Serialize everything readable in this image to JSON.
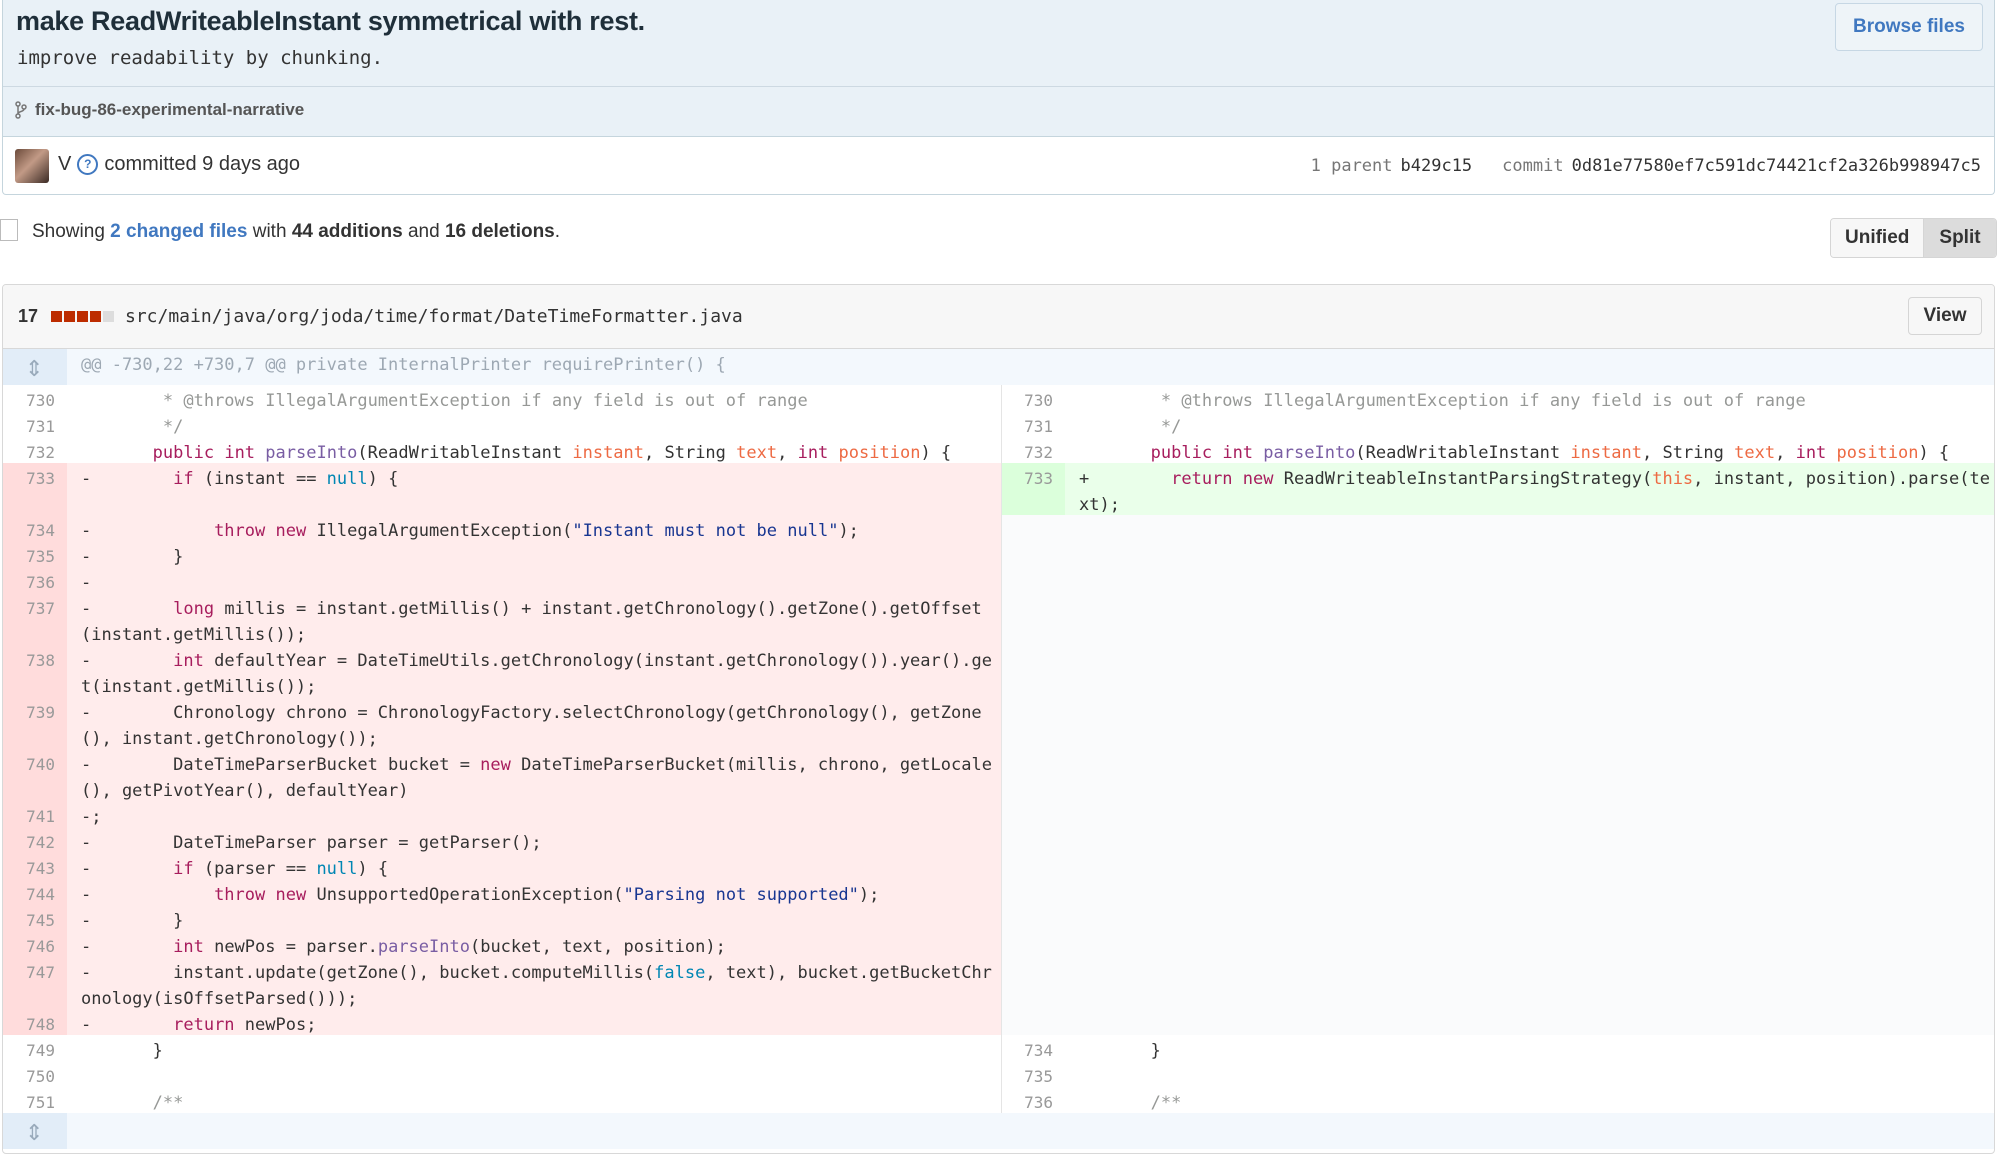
{
  "commit": {
    "title": "make ReadWriteableInstant symmetrical with rest.",
    "description": "improve readability by chunking.",
    "branch": "fix-bug-86-experimental-narrative",
    "browse_files_label": "Browse files",
    "author": "V",
    "committed_text": "committed 9 days ago",
    "parent_label": "1 parent",
    "parent_sha": "b429c15",
    "commit_label": "commit",
    "commit_sha": "0d81e77580ef7c591dc74421cf2a326b998947c5"
  },
  "toc": {
    "showing": "Showing",
    "changed_files": "2 changed files",
    "with": "with",
    "additions": "44 additions",
    "and": "and",
    "deletions": "16 deletions",
    "period": "."
  },
  "view_toggle": {
    "unified": "Unified",
    "split": "Split",
    "selected": "Split"
  },
  "file": {
    "change_count": "17",
    "path": "src/main/java/org/joda/time/format/DateTimeFormatter.java",
    "view_label": "View",
    "diffstat": {
      "deletions_blocks": 4,
      "additions_blocks": 0,
      "neutral_blocks": 1
    },
    "colors": {
      "deletion": "#bd2c00",
      "addition": "#6cc644",
      "neutral": "#dddddd"
    },
    "hunk_header": "@@ -730,22 +730,7 @@ private InternalPrinter requirePrinter() {"
  },
  "diff": {
    "left": [
      {
        "n": "730",
        "t": "        * @throws IllegalArgumentException if any field is out of range"
      },
      {
        "n": "731",
        "t": "        */"
      },
      {
        "n": "732",
        "t": "       public int parseInto(ReadWritableInstant instant, String text, int position) {"
      },
      {
        "n": "733",
        "t": "-        if (instant == null) {"
      },
      {
        "n": "734",
        "t": "-            throw new IllegalArgumentException(\"Instant must not be null\");"
      },
      {
        "n": "735",
        "t": "-        }"
      },
      {
        "n": "736",
        "t": "-"
      },
      {
        "n": "737",
        "t": "-        long millis = instant.getMillis() + instant.getChronology().getZone().getOffset(instant.getMillis());"
      },
      {
        "n": "738",
        "t": "-        int defaultYear = DateTimeUtils.getChronology(instant.getChronology()).year().get(instant.getMillis());"
      },
      {
        "n": "739",
        "t": "-        Chronology chrono = ChronologyFactory.selectChronology(getChronology(), getZone(), instant.getChronology());"
      },
      {
        "n": "740",
        "t": "-        DateTimeParserBucket bucket = new DateTimeParserBucket(millis, chrono, getLocale(), getPivotYear(), defaultYear)"
      },
      {
        "n": "741",
        "t": "-;"
      },
      {
        "n": "742",
        "t": "-        DateTimeParser parser = getParser();"
      },
      {
        "n": "743",
        "t": "-        if (parser == null) {"
      },
      {
        "n": "744",
        "t": "-            throw new UnsupportedOperationException(\"Parsing not supported\");"
      },
      {
        "n": "745",
        "t": "-        }"
      },
      {
        "n": "746",
        "t": "-        int newPos = parser.parseInto(bucket, text, position);"
      },
      {
        "n": "747",
        "t": "-        instant.update(getZone(), bucket.computeMillis(false, text), bucket.getBucketChronology(isOffsetParsed()));"
      },
      {
        "n": "748",
        "t": "-        return newPos;"
      },
      {
        "n": "749",
        "t": "       }"
      },
      {
        "n": "750",
        "t": ""
      },
      {
        "n": "751",
        "t": "       /**"
      }
    ],
    "right": [
      {
        "n": "730",
        "t": "        * @throws IllegalArgumentException if any field is out of range"
      },
      {
        "n": "731",
        "t": "        */"
      },
      {
        "n": "732",
        "t": "       public int parseInto(ReadWritableInstant instant, String text, int position) {"
      },
      {
        "n": "733",
        "t": "+        return new ReadWriteableInstantParsingStrategy(this, instant, position).parse(text);"
      },
      {
        "n": "734",
        "t": "       }"
      },
      {
        "n": "735",
        "t": ""
      },
      {
        "n": "736",
        "t": "       /**"
      }
    ]
  }
}
